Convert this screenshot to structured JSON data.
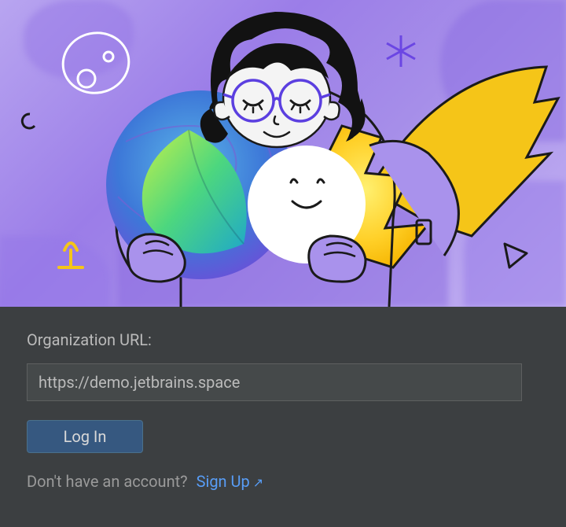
{
  "form": {
    "label": "Organization URL:",
    "url_value": "https://demo.jetbrains.space",
    "login_label": "Log In",
    "signup_prompt": "Don't have an account?",
    "signup_link": "Sign Up"
  },
  "colors": {
    "panel_bg": "#3c3f41",
    "input_bg": "#45494a",
    "button_bg": "#365880",
    "link": "#589df6",
    "text": "#bbbbbb"
  },
  "icons": {
    "external": "↗"
  }
}
